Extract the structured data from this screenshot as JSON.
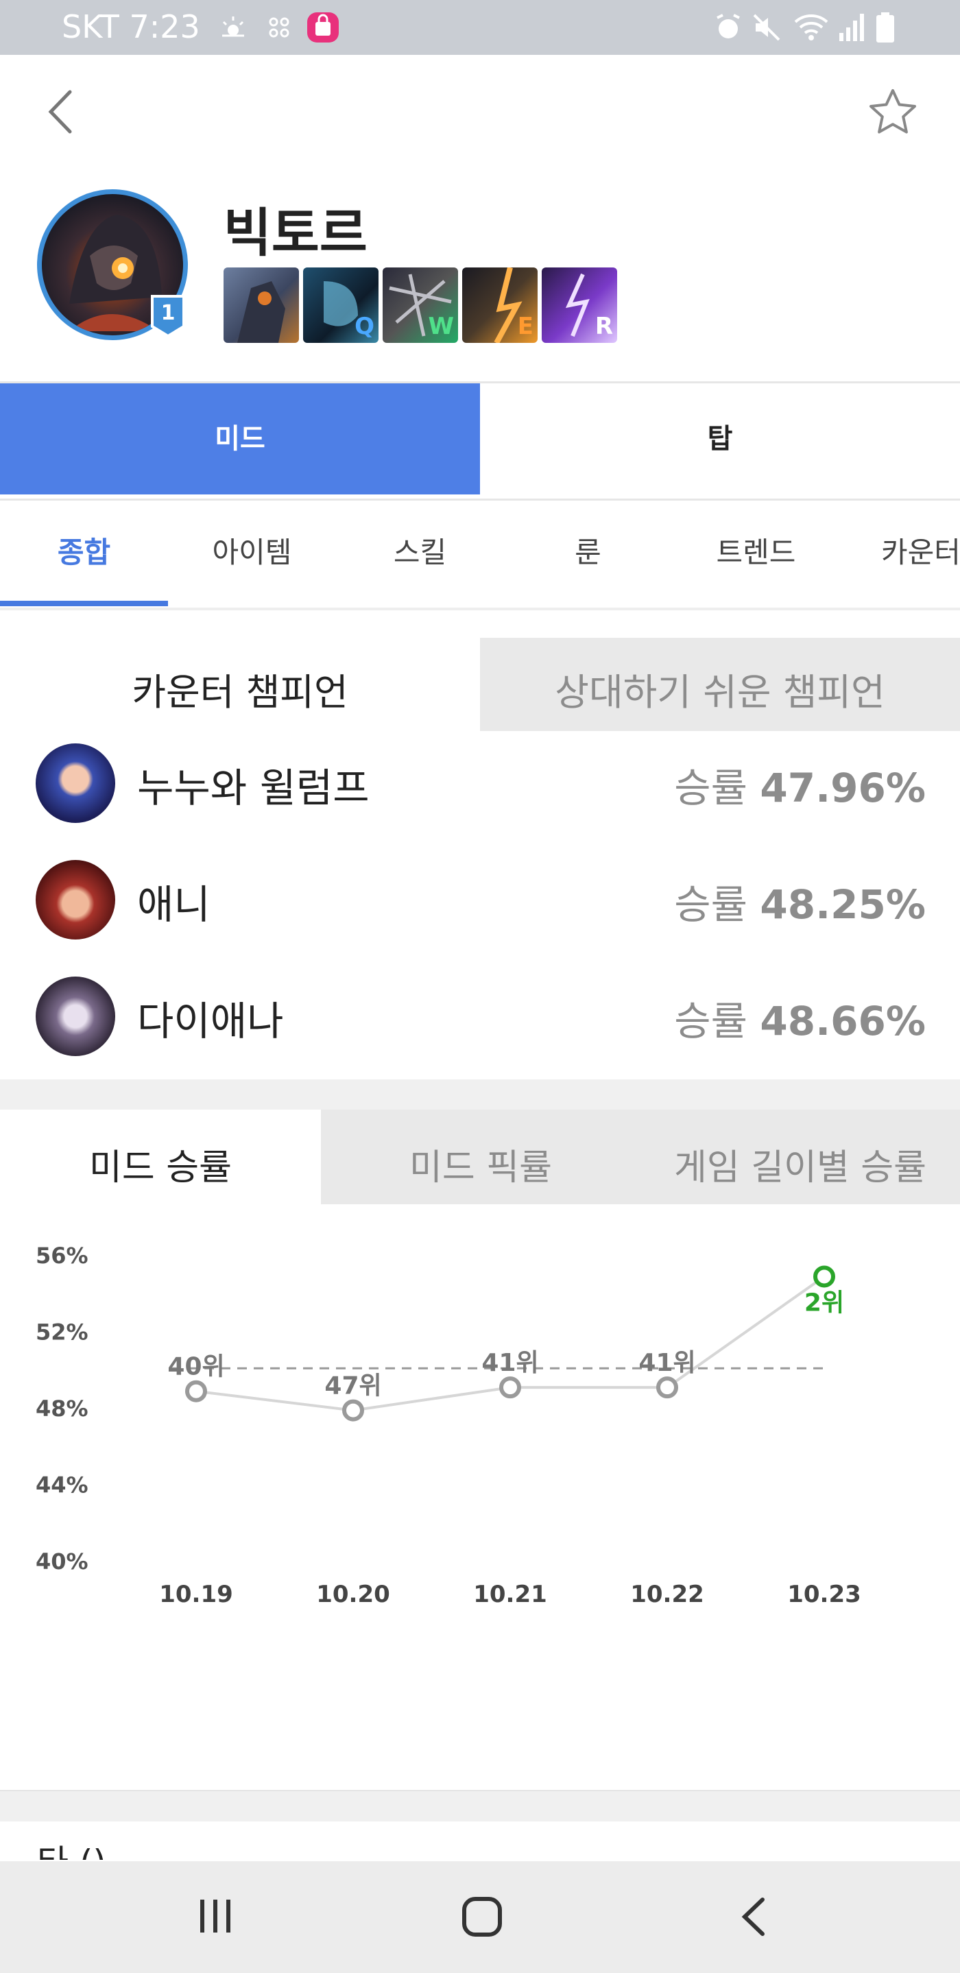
{
  "status_bar": {
    "carrier_time": "SKT 7:23"
  },
  "header": {
    "champion_name": "빅토르",
    "level_badge": "1",
    "skills": [
      {
        "key": "",
        "name": "passive"
      },
      {
        "key": "Q",
        "name": "Q"
      },
      {
        "key": "W",
        "name": "W"
      },
      {
        "key": "E",
        "name": "E"
      },
      {
        "key": "R",
        "name": "R"
      }
    ]
  },
  "role_tabs": [
    "미드",
    "탑"
  ],
  "sub_tabs": [
    "종합",
    "아이템",
    "스킬",
    "룬",
    "트렌드",
    "카운터"
  ],
  "counter": {
    "tabs": [
      "카운터 챔피언",
      "상대하기 쉬운 챔피언"
    ],
    "winrate_label": "승률",
    "rows": [
      {
        "name": "누누와 윌럼프",
        "winrate": "47.96%"
      },
      {
        "name": "애니",
        "winrate": "48.25%"
      },
      {
        "name": "다이애나",
        "winrate": "48.66%"
      }
    ]
  },
  "chart_tabs": [
    "미드 승률",
    "미드 픽률",
    "게임 길이별 승률"
  ],
  "chart_data": {
    "type": "line",
    "title": "미드 승률",
    "categories": [
      "10.19",
      "10.20",
      "10.21",
      "10.22",
      "10.23"
    ],
    "values": [
      48.8,
      47.8,
      49.0,
      49.0,
      54.8
    ],
    "point_labels": [
      "40위",
      "47위",
      "41위",
      "41위",
      "2위"
    ],
    "yticks": [
      "56%",
      "52%",
      "48%",
      "44%",
      "40%"
    ],
    "ylim": [
      40,
      56
    ],
    "reference_line": 50,
    "highlight_color": "#2aa52a",
    "line_color": "#d6d6d6"
  },
  "next_section_title": "타 ()"
}
